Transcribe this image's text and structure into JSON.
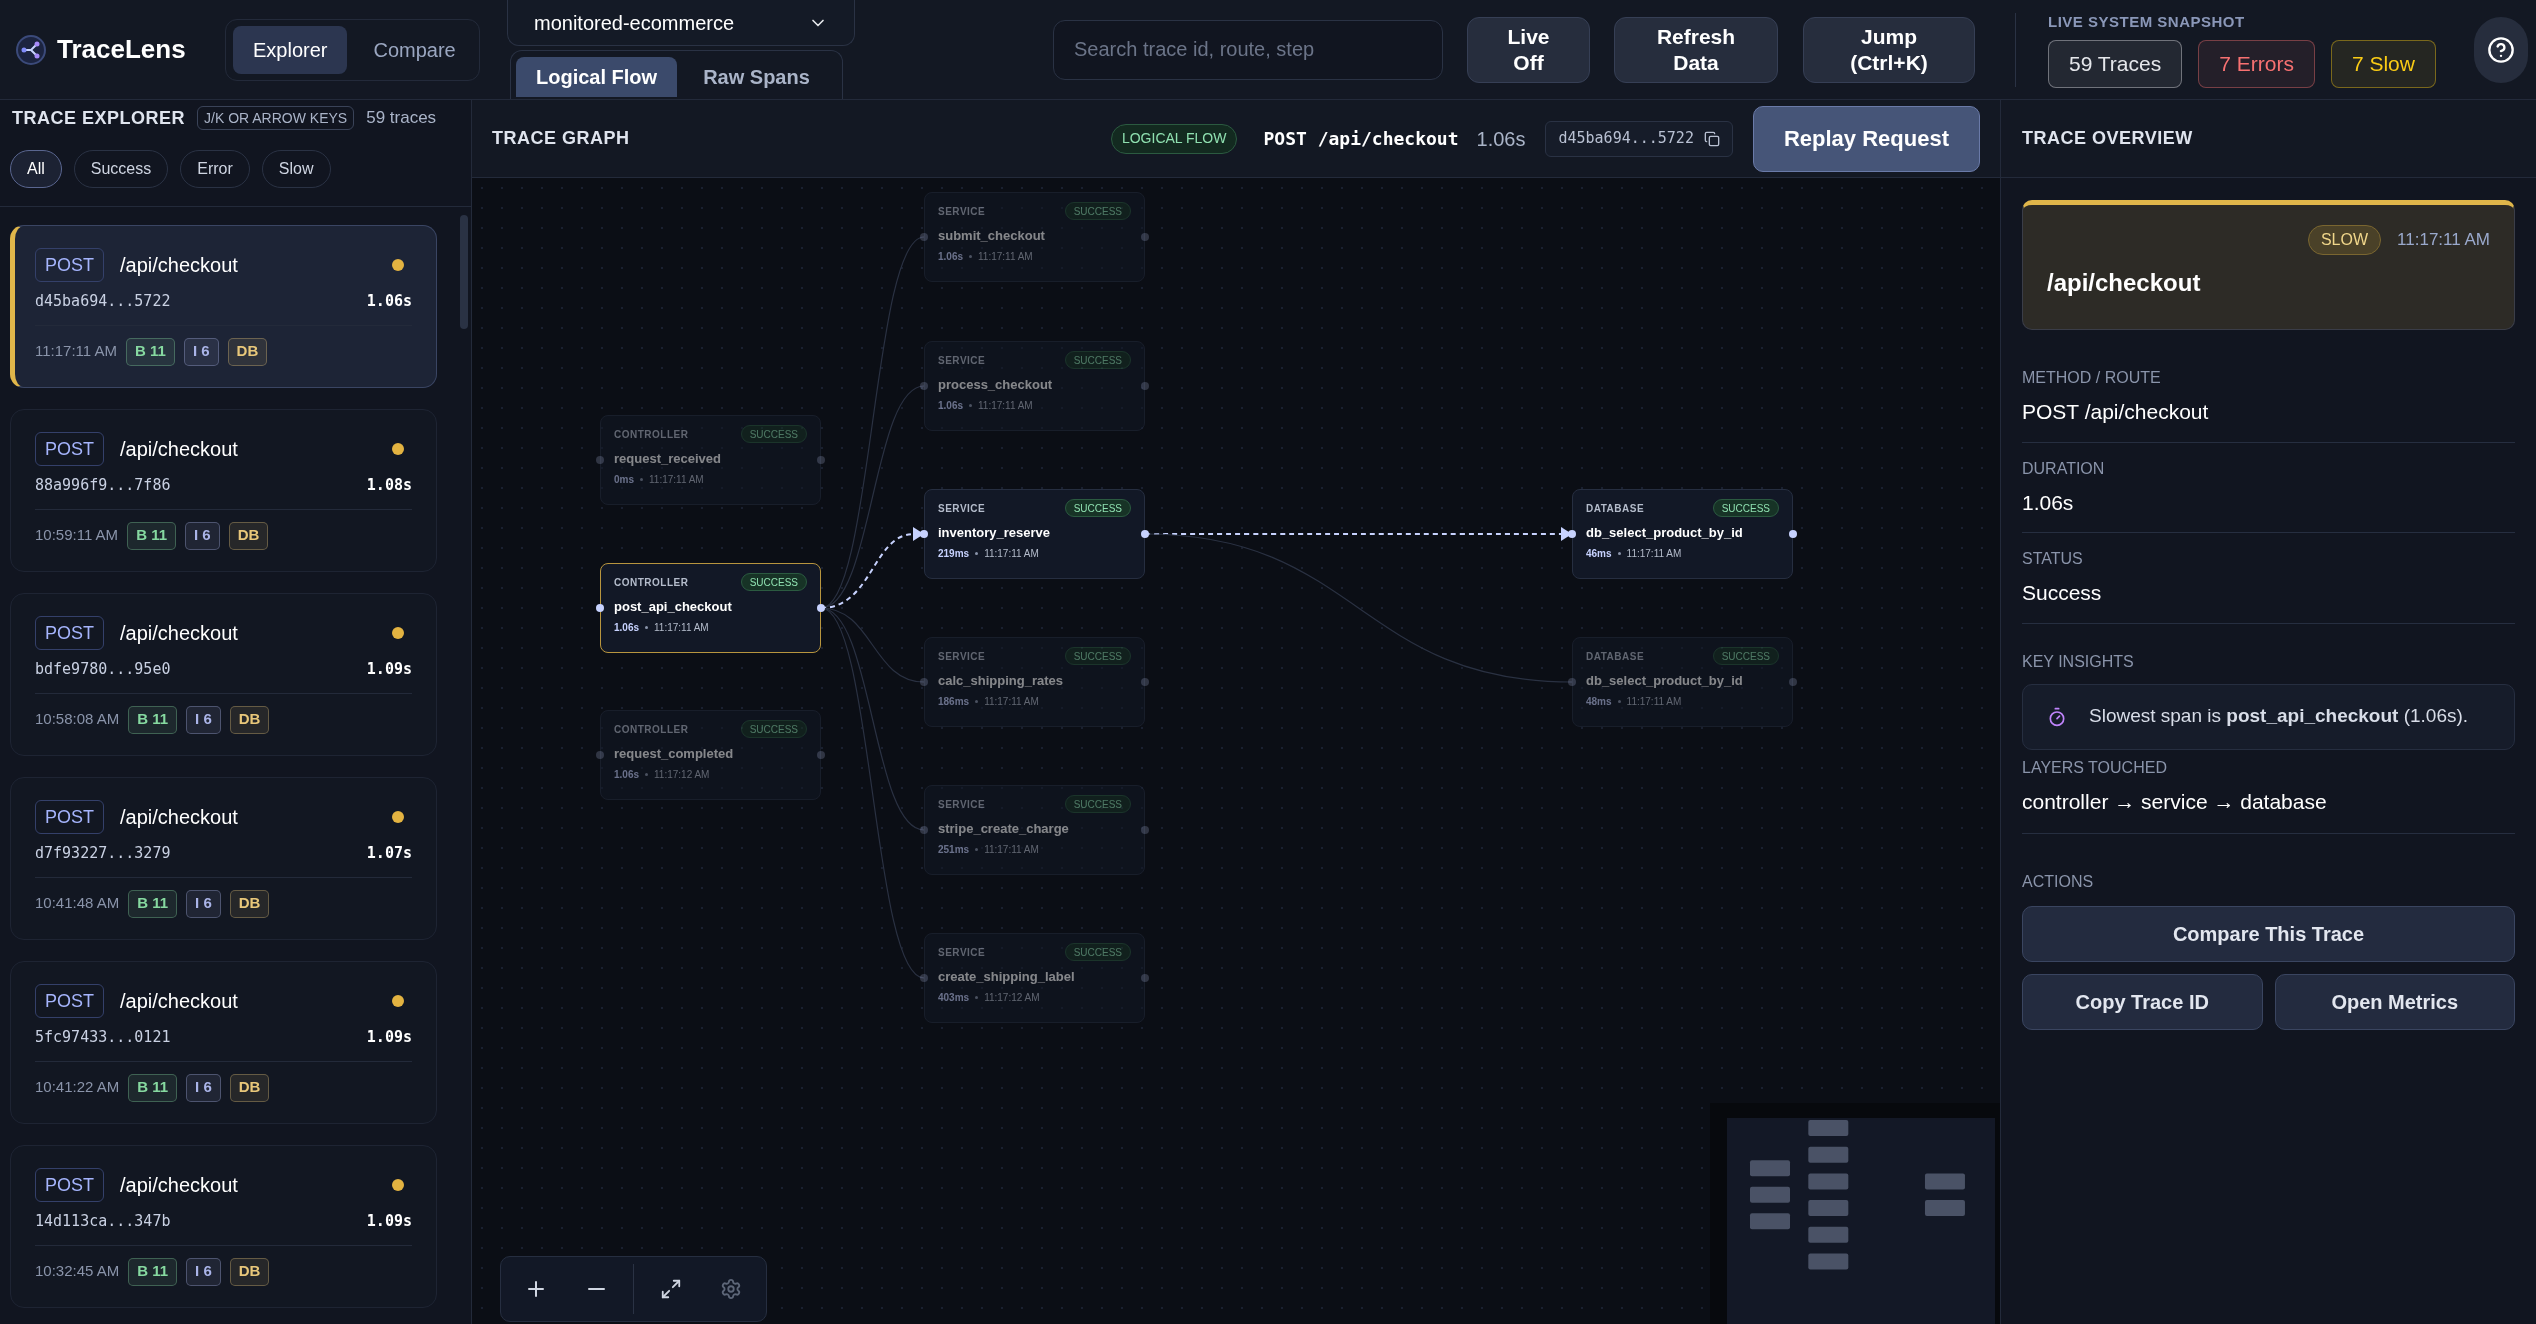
{
  "app": {
    "name": "TraceLens"
  },
  "mode_tabs": [
    {
      "label": "Explorer",
      "selected": true
    },
    {
      "label": "Compare",
      "selected": false
    }
  ],
  "project_select": {
    "value": "monitored-ecommerce"
  },
  "view_tabs": [
    {
      "label": "Logical Flow",
      "selected": true
    },
    {
      "label": "Raw Spans",
      "selected": false
    }
  ],
  "search": {
    "placeholder": "Search trace id, route, step"
  },
  "toolbar_buttons": [
    {
      "lines": [
        "Live",
        "Off"
      ]
    },
    {
      "lines": [
        "Refresh",
        "Data"
      ]
    },
    {
      "lines": [
        "Jump",
        "(Ctrl+K)"
      ]
    }
  ],
  "snapshot": {
    "title": "LIVE SYSTEM SNAPSHOT",
    "chips": [
      {
        "label": "59 Traces",
        "color": "#e5e7eb"
      },
      {
        "label": "7 Errors",
        "color": "#f87171"
      },
      {
        "label": "7 Slow",
        "color": "#facc15"
      }
    ]
  },
  "explorer": {
    "title": "TRACE EXPLORER",
    "hint": "J/K OR ARROW KEYS",
    "count": "59 traces",
    "filters": [
      {
        "label": "All",
        "selected": true
      },
      {
        "label": "Success",
        "selected": false
      },
      {
        "label": "Error",
        "selected": false
      },
      {
        "label": "Slow",
        "selected": false
      }
    ],
    "traces": [
      {
        "method": "POST",
        "route": "/api/checkout",
        "id": "d45ba694...5722",
        "duration": "1.06s",
        "time": "11:17:11 AM",
        "color": "#e3b341",
        "selected": true,
        "badges": [
          {
            "label": "B 11",
            "color": "#86d9a0"
          },
          {
            "label": "I 6",
            "color": "#aab4e8"
          },
          {
            "label": "DB",
            "color": "#e8c77a"
          }
        ]
      },
      {
        "method": "POST",
        "route": "/api/checkout",
        "id": "88a996f9...7f86",
        "duration": "1.08s",
        "time": "10:59:11 AM",
        "color": "#e3b341",
        "selected": false,
        "badges": [
          {
            "label": "B 11",
            "color": "#86d9a0"
          },
          {
            "label": "I 6",
            "color": "#aab4e8"
          },
          {
            "label": "DB",
            "color": "#e8c77a"
          }
        ]
      },
      {
        "method": "POST",
        "route": "/api/checkout",
        "id": "bdfe9780...95e0",
        "duration": "1.09s",
        "time": "10:58:08 AM",
        "color": "#e3b341",
        "selected": false,
        "badges": [
          {
            "label": "B 11",
            "color": "#86d9a0"
          },
          {
            "label": "I 6",
            "color": "#aab4e8"
          },
          {
            "label": "DB",
            "color": "#e8c77a"
          }
        ]
      },
      {
        "method": "POST",
        "route": "/api/checkout",
        "id": "d7f93227...3279",
        "duration": "1.07s",
        "time": "10:41:48 AM",
        "color": "#e3b341",
        "selected": false,
        "badges": [
          {
            "label": "B 11",
            "color": "#86d9a0"
          },
          {
            "label": "I 6",
            "color": "#aab4e8"
          },
          {
            "label": "DB",
            "color": "#e8c77a"
          }
        ]
      },
      {
        "method": "POST",
        "route": "/api/checkout",
        "id": "5fc97433...0121",
        "duration": "1.09s",
        "time": "10:41:22 AM",
        "color": "#e3b341",
        "selected": false,
        "badges": [
          {
            "label": "B 11",
            "color": "#86d9a0"
          },
          {
            "label": "I 6",
            "color": "#aab4e8"
          },
          {
            "label": "DB",
            "color": "#e8c77a"
          }
        ]
      },
      {
        "method": "POST",
        "route": "/api/checkout",
        "id": "14d113ca...347b",
        "duration": "1.09s",
        "time": "10:32:45 AM",
        "color": "#e3b341",
        "selected": false,
        "badges": [
          {
            "label": "B 11",
            "color": "#86d9a0"
          },
          {
            "label": "I 6",
            "color": "#aab4e8"
          },
          {
            "label": "DB",
            "color": "#e8c77a"
          }
        ]
      }
    ]
  },
  "graph": {
    "title": "TRACE GRAPH",
    "mode": "LOGICAL FLOW",
    "request": "POST /api/checkout",
    "duration": "1.06s",
    "trace_id": "d45ba694...5722",
    "action": "Replay Request",
    "nodes": [
      {
        "layer": "SERVICE",
        "status": "SUCCESS",
        "name": "submit_checkout",
        "duration": "1.06s",
        "time": "11:17:11 AM",
        "dimmed": true,
        "selected": false
      },
      {
        "layer": "SERVICE",
        "status": "SUCCESS",
        "name": "process_checkout",
        "duration": "1.06s",
        "time": "11:17:11 AM",
        "dimmed": true,
        "selected": false
      },
      {
        "layer": "CONTROLLER",
        "status": "SUCCESS",
        "name": "request_received",
        "duration": "0ms",
        "time": "11:17:11 AM",
        "dimmed": true,
        "selected": false
      },
      {
        "layer": "SERVICE",
        "status": "SUCCESS",
        "name": "inventory_reserve",
        "duration": "219ms",
        "time": "11:17:11 AM",
        "dimmed": false,
        "selected": false
      },
      {
        "layer": "DATABASE",
        "status": "SUCCESS",
        "name": "db_select_product_by_id",
        "duration": "46ms",
        "time": "11:17:11 AM",
        "dimmed": false,
        "selected": false
      },
      {
        "layer": "CONTROLLER",
        "status": "SUCCESS",
        "name": "post_api_checkout",
        "duration": "1.06s",
        "time": "11:17:11 AM",
        "dimmed": false,
        "selected": true
      },
      {
        "layer": "SERVICE",
        "status": "SUCCESS",
        "name": "calc_shipping_rates",
        "duration": "186ms",
        "time": "11:17:11 AM",
        "dimmed": true,
        "selected": false
      },
      {
        "layer": "DATABASE",
        "status": "SUCCESS",
        "name": "db_select_product_by_id",
        "duration": "48ms",
        "time": "11:17:11 AM",
        "dimmed": true,
        "selected": false
      },
      {
        "layer": "CONTROLLER",
        "status": "SUCCESS",
        "name": "request_completed",
        "duration": "1.06s",
        "time": "11:17:12 AM",
        "dimmed": true,
        "selected": false
      },
      {
        "layer": "SERVICE",
        "status": "SUCCESS",
        "name": "stripe_create_charge",
        "duration": "251ms",
        "time": "11:17:11 AM",
        "dimmed": true,
        "selected": false
      },
      {
        "layer": "SERVICE",
        "status": "SUCCESS",
        "name": "create_shipping_label",
        "duration": "403ms",
        "time": "11:17:12 AM",
        "dimmed": true,
        "selected": false
      }
    ],
    "edges": [
      {
        "highlighted": false
      },
      {
        "highlighted": false
      },
      {
        "highlighted": true
      },
      {
        "highlighted": false
      },
      {
        "highlighted": false
      },
      {
        "highlighted": false
      },
      {
        "highlighted": true
      },
      {
        "highlighted": false
      }
    ]
  },
  "overview": {
    "title": "TRACE OVERVIEW",
    "badge": "SLOW",
    "time": "11:17:11 AM",
    "route": "/api/checkout",
    "fields": [
      {
        "label": "METHOD / ROUTE",
        "value": "POST /api/checkout"
      },
      {
        "label": "DURATION",
        "value": "1.06s"
      },
      {
        "label": "STATUS",
        "value": "Success"
      }
    ],
    "insights_title": "KEY INSIGHTS",
    "insights": [
      "Slowest span is **post_api_checkout** (1.06s)."
    ],
    "layers": {
      "label": "LAYERS TOUCHED",
      "value": "controller → service → database"
    },
    "actions_title": "ACTIONS",
    "actions": [
      "Compare This Trace",
      "Copy Trace ID",
      "Open Metrics"
    ]
  }
}
